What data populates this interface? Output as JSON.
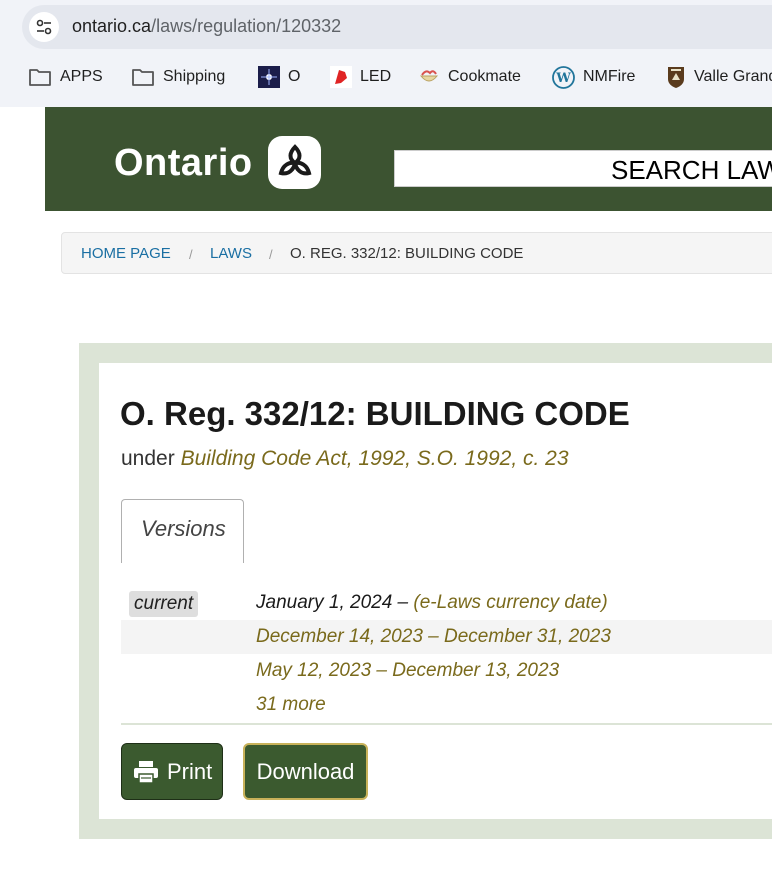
{
  "browser": {
    "url_host": "ontario.ca",
    "url_path": "/laws/regulation/120332",
    "bookmarks": [
      {
        "label": "APPS",
        "icon": "folder-icon"
      },
      {
        "label": "Shipping",
        "icon": "folder-icon"
      },
      {
        "label": "O",
        "icon": "star-favicon-icon"
      },
      {
        "label": "LED",
        "icon": "led-favicon-icon"
      },
      {
        "label": "Cookmate",
        "icon": "cookmate-favicon-icon"
      },
      {
        "label": "NMFire",
        "icon": "wordpress-icon"
      },
      {
        "label": "Valle Grand",
        "icon": "nps-favicon-icon"
      }
    ]
  },
  "header": {
    "logo_text": "Ontario",
    "search_label": "SEARCH LAW",
    "brand_color": "#3c5331"
  },
  "breadcrumb": {
    "home": "HOME PAGE",
    "laws": "LAWS",
    "current": "O. REG. 332/12: BUILDING CODE",
    "separator": "/"
  },
  "regulation": {
    "title": "O. Reg. 332/12: BUILDING CODE",
    "under_prefix": "under",
    "act": "Building Code Act, 1992, S.O. 1992, c. 23"
  },
  "versions": {
    "tab_label": "Versions",
    "current_badge": "current",
    "current_date": "January 1, 2024 –",
    "current_note": "(e-Laws currency date)",
    "rows": [
      "December 14, 2023 – December 31, 2023",
      "May 12, 2023 – December 13, 2023",
      "31 more"
    ]
  },
  "actions": {
    "print_label": "Print",
    "download_label": "Download"
  },
  "colors": {
    "accent_gold": "#7a6a1c",
    "button_green": "#3b5a2f",
    "panel_border": "#dce4d6",
    "link_blue": "#1a6fa3"
  }
}
